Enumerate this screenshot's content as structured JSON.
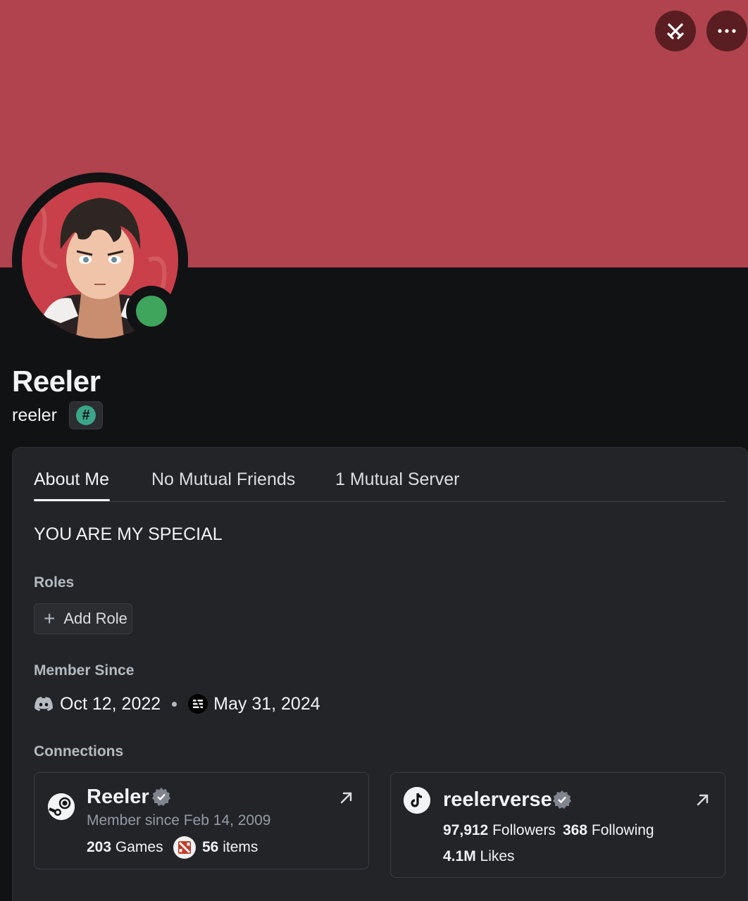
{
  "colors": {
    "banner": "#b0434d",
    "background": "#111214",
    "card": "#232428",
    "online": "#3fa55c",
    "tag_badge": "#3ba58a"
  },
  "header": {
    "top_buttons": [
      {
        "icon": "swords-icon"
      },
      {
        "icon": "more-icon"
      }
    ]
  },
  "profile": {
    "display_name": "Reeler",
    "username": "reeler",
    "status": "online",
    "tag_icon": "#"
  },
  "tabs": [
    {
      "label": "About Me",
      "active": true
    },
    {
      "label": "No Mutual Friends",
      "active": false
    },
    {
      "label": "1 Mutual Server",
      "active": false
    }
  ],
  "about": {
    "bio": "YOU ARE MY SPECIAL",
    "roles_label": "Roles",
    "add_role_label": "Add Role",
    "member_since_label": "Member Since",
    "discord_since": "Oct 12, 2022",
    "server_since": "May 31, 2024",
    "connections_label": "Connections"
  },
  "connections": {
    "steam": {
      "name": "Reeler",
      "subtitle": "Member since Feb 14, 2009",
      "games_count": "203",
      "games_label": "Games",
      "items_count": "56",
      "items_label": "items"
    },
    "tiktok": {
      "name": "reelerverse",
      "followers_count": "97,912",
      "followers_label": "Followers",
      "following_count": "368",
      "following_label": "Following",
      "likes_count": "4.1M",
      "likes_label": "Likes"
    }
  }
}
